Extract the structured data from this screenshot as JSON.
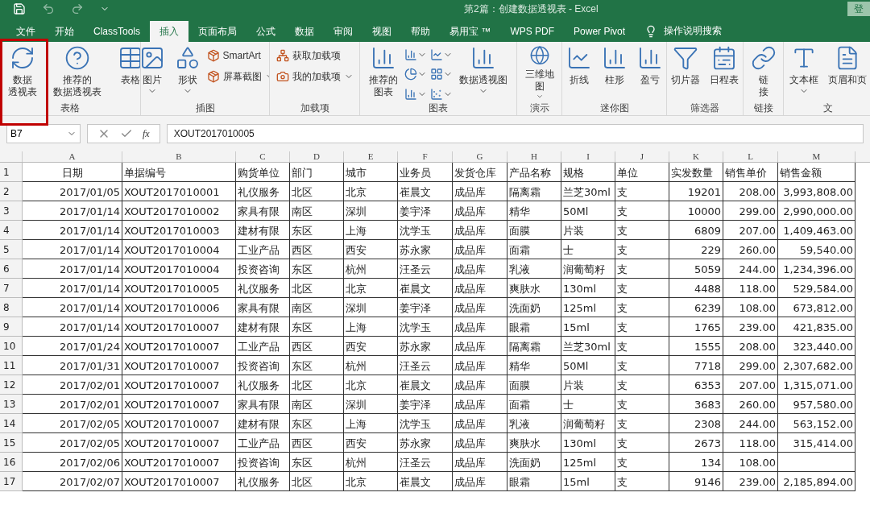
{
  "title_bar": {
    "title": "第2篇：创建数据透视表  -  Excel",
    "sign_in": "登"
  },
  "tabs": [
    {
      "label": "文件",
      "selected": false
    },
    {
      "label": "开始",
      "selected": false
    },
    {
      "label": "ClassTools",
      "selected": false
    },
    {
      "label": "插入",
      "selected": true
    },
    {
      "label": "页面布局",
      "selected": false
    },
    {
      "label": "公式",
      "selected": false
    },
    {
      "label": "数据",
      "selected": false
    },
    {
      "label": "审阅",
      "selected": false
    },
    {
      "label": "视图",
      "selected": false
    },
    {
      "label": "帮助",
      "selected": false
    },
    {
      "label": "易用宝 ™",
      "selected": false
    },
    {
      "label": "WPS PDF",
      "selected": false
    },
    {
      "label": "Power Pivot",
      "selected": false
    }
  ],
  "tell_me": "操作说明搜索",
  "ribbon_groups": [
    {
      "label": "表格",
      "items": [
        {
          "kind": "large",
          "lines": [
            "数据",
            "透视表"
          ],
          "dropdown": false
        },
        {
          "kind": "large",
          "lines": [
            "推荐的",
            "数据透视表"
          ],
          "dropdown": false
        },
        {
          "kind": "large",
          "lines": [
            "表格"
          ],
          "dropdown": false
        }
      ]
    },
    {
      "label": "插图",
      "items": [
        {
          "kind": "large",
          "lines": [
            "图片"
          ],
          "dropdown": true
        },
        {
          "kind": "large",
          "lines": [
            "形状"
          ],
          "dropdown": true
        },
        {
          "kind": "stack",
          "entries": [
            {
              "label": "SmartArt",
              "dropdown": false
            },
            {
              "label": "屏幕截图",
              "dropdown": true
            }
          ]
        }
      ]
    },
    {
      "label": "加载项",
      "items": [
        {
          "kind": "stack",
          "entries": [
            {
              "label": "获取加载项",
              "dropdown": false
            },
            {
              "label": "我的加载项",
              "dropdown": true
            }
          ]
        }
      ]
    },
    {
      "label": "图表",
      "items": [
        {
          "kind": "large",
          "lines": [
            "推荐的",
            "图表"
          ],
          "dropdown": false
        },
        {
          "kind": "icons"
        },
        {
          "kind": "large",
          "lines": [
            "数据透视图"
          ],
          "dropdown": true
        }
      ]
    },
    {
      "label": "演示",
      "items": [
        {
          "kind": "large",
          "lines": [
            "三维地",
            "图"
          ],
          "dropdown": true
        }
      ]
    },
    {
      "label": "迷你图",
      "items": [
        {
          "kind": "large",
          "lines": [
            "折线"
          ],
          "dropdown": false
        },
        {
          "kind": "large",
          "lines": [
            "柱形"
          ],
          "dropdown": false
        },
        {
          "kind": "large",
          "lines": [
            "盈亏"
          ],
          "dropdown": false
        }
      ]
    },
    {
      "label": "筛选器",
      "items": [
        {
          "kind": "large",
          "lines": [
            "切片器"
          ],
          "dropdown": false
        },
        {
          "kind": "large",
          "lines": [
            "日程表"
          ],
          "dropdown": false
        }
      ]
    },
    {
      "label": "链接",
      "items": [
        {
          "kind": "large",
          "lines": [
            "链",
            "接"
          ],
          "dropdown": false
        }
      ]
    },
    {
      "label": "文",
      "items": [
        {
          "kind": "large",
          "lines": [
            "文本框"
          ],
          "dropdown": true
        },
        {
          "kind": "large",
          "lines": [
            "页眉和页"
          ],
          "dropdown": false
        }
      ]
    }
  ],
  "formula_bar": {
    "name_box": "B7",
    "fx": "fx",
    "value": "XOUT2017010005"
  },
  "columns": [
    "A",
    "B",
    "C",
    "D",
    "E",
    "F",
    "G",
    "H",
    "I",
    "J",
    "K",
    "L",
    "M"
  ],
  "rows": [
    {
      "num": "1",
      "cells": [
        "日期",
        "单据编号",
        "购货单位",
        "部门",
        "城市",
        "业务员",
        "发货仓库",
        "产品名称",
        "规格",
        "单位",
        "实发数量",
        "销售单价",
        "销售金额"
      ]
    },
    {
      "num": "2",
      "cells": [
        "2017/01/05",
        "XOUT2017010001",
        "礼仪服务",
        "北区",
        "北京",
        "崔晨文",
        "成品库",
        "隔离霜",
        "兰芝30ml",
        "支",
        "19201",
        "208.00",
        "3,993,808.00"
      ]
    },
    {
      "num": "3",
      "cells": [
        "2017/01/14",
        "XOUT2017010002",
        "家具有限",
        "南区",
        "深圳",
        "姜宇泽",
        "成品库",
        "精华",
        "50Ml",
        "支",
        "10000",
        "299.00",
        "2,990,000.00"
      ]
    },
    {
      "num": "4",
      "cells": [
        "2017/01/14",
        "XOUT2017010003",
        "建材有限",
        "东区",
        "上海",
        "沈学玉",
        "成品库",
        "面膜",
        "片装",
        "支",
        "6809",
        "207.00",
        "1,409,463.00"
      ]
    },
    {
      "num": "5",
      "cells": [
        "2017/01/14",
        "XOUT2017010004",
        "工业产品",
        "西区",
        "西安",
        "苏永家",
        "成品库",
        "面霜",
        "士",
        "支",
        "229",
        "260.00",
        "59,540.00"
      ]
    },
    {
      "num": "6",
      "cells": [
        "2017/01/14",
        "XOUT2017010004",
        "投资咨询",
        "东区",
        "杭州",
        "汪圣云",
        "成品库",
        "乳液",
        "润葡萄籽",
        "支",
        "5059",
        "244.00",
        "1,234,396.00"
      ]
    },
    {
      "num": "7",
      "cells": [
        "2017/01/14",
        "XOUT2017010005",
        "礼仪服务",
        "北区",
        "北京",
        "崔晨文",
        "成品库",
        "爽肤水",
        "130ml",
        "支",
        "4488",
        "118.00",
        "529,584.00"
      ]
    },
    {
      "num": "8",
      "cells": [
        "2017/01/14",
        "XOUT2017010006",
        "家具有限",
        "南区",
        "深圳",
        "姜宇泽",
        "成品库",
        "洗面奶",
        "125ml",
        "支",
        "6239",
        "108.00",
        "673,812.00"
      ]
    },
    {
      "num": "9",
      "cells": [
        "2017/01/14",
        "XOUT2017010007",
        "建材有限",
        "东区",
        "上海",
        "沈学玉",
        "成品库",
        "眼霜",
        "15ml",
        "支",
        "1765",
        "239.00",
        "421,835.00"
      ]
    },
    {
      "num": "10",
      "cells": [
        "2017/01/24",
        "XOUT2017010007",
        "工业产品",
        "西区",
        "西安",
        "苏永家",
        "成品库",
        "隔离霜",
        "兰芝30ml",
        "支",
        "1555",
        "208.00",
        "323,440.00"
      ]
    },
    {
      "num": "11",
      "cells": [
        "2017/01/31",
        "XOUT2017010007",
        "投资咨询",
        "东区",
        "杭州",
        "汪圣云",
        "成品库",
        "精华",
        "50Ml",
        "支",
        "7718",
        "299.00",
        "2,307,682.00"
      ]
    },
    {
      "num": "12",
      "cells": [
        "2017/02/01",
        "XOUT2017010007",
        "礼仪服务",
        "北区",
        "北京",
        "崔晨文",
        "成品库",
        "面膜",
        "片装",
        "支",
        "6353",
        "207.00",
        "1,315,071.00"
      ]
    },
    {
      "num": "13",
      "cells": [
        "2017/02/01",
        "XOUT2017010007",
        "家具有限",
        "南区",
        "深圳",
        "姜宇泽",
        "成品库",
        "面霜",
        "士",
        "支",
        "3683",
        "260.00",
        "957,580.00"
      ]
    },
    {
      "num": "14",
      "cells": [
        "2017/02/05",
        "XOUT2017010007",
        "建材有限",
        "东区",
        "上海",
        "沈学玉",
        "成品库",
        "乳液",
        "润葡萄籽",
        "支",
        "2308",
        "244.00",
        "563,152.00"
      ]
    },
    {
      "num": "15",
      "cells": [
        "2017/02/05",
        "XOUT2017010007",
        "工业产品",
        "西区",
        "西安",
        "苏永家",
        "成品库",
        "爽肤水",
        "130ml",
        "支",
        "2673",
        "118.00",
        "315,414.00"
      ]
    },
    {
      "num": "16",
      "cells": [
        "2017/02/06",
        "XOUT2017010007",
        "投资咨询",
        "东区",
        "杭州",
        "汪圣云",
        "成品库",
        "洗面奶",
        "125ml",
        "支",
        "134",
        "108.00"
      ]
    },
    {
      "num": "17",
      "cells": [
        "2017/02/07",
        "XOUT2017010007",
        "礼仪服务",
        "北区",
        "北京",
        "崔晨文",
        "成品库",
        "眼霜",
        "15ml",
        "支",
        "9146",
        "239.00",
        "2,185,894.00"
      ]
    }
  ]
}
